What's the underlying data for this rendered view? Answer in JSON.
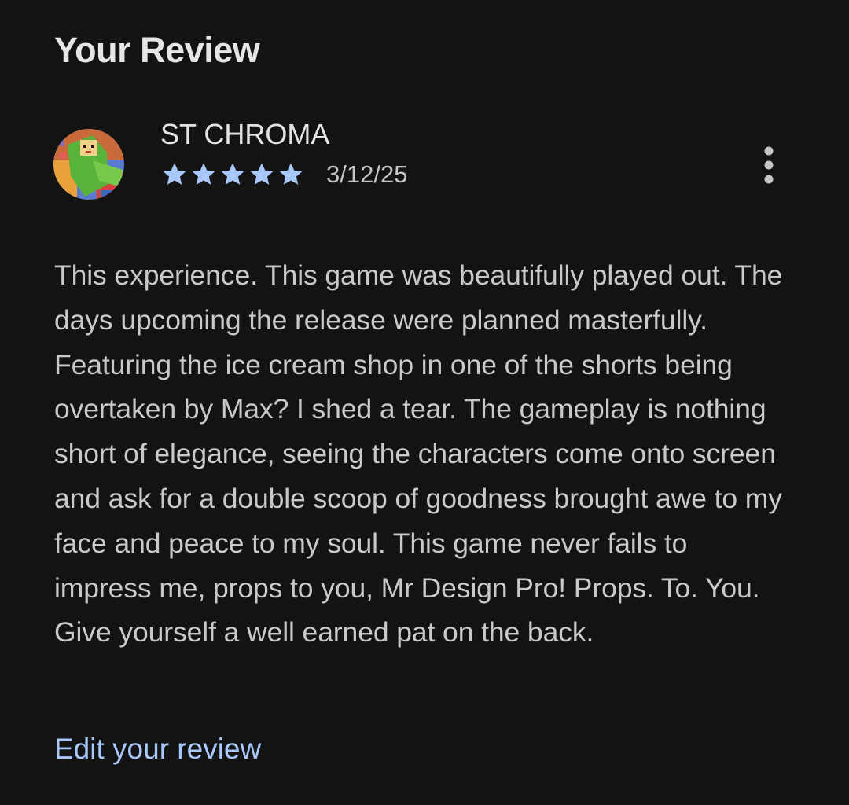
{
  "section": {
    "title": "Your Review"
  },
  "review": {
    "reviewer_name": "ST CHROMA",
    "rating": 5,
    "rating_max": 5,
    "date": "3/12/25",
    "text": "This experience. This game was beautifully played out. The days upcoming the release were planned masterfully. Featuring the ice cream shop in one of the shorts being overtaken by Max? I shed a tear. The gameplay is nothing short of elegance, seeing the characters come onto screen and ask for a double scoop of goodness brought awe to my face and peace to my soul. This game never fails to impress me, props to you, Mr Design Pro! Props. To. You. Give yourself a well earned pat on the back.",
    "more_icon": "more-vert-icon",
    "star_icon": "star-icon"
  },
  "actions": {
    "edit_label": "Edit your review"
  },
  "colors": {
    "background": "#131313",
    "star": "#a8c7fa",
    "link": "#a8c7fa",
    "body_text": "#c9c9c9"
  }
}
